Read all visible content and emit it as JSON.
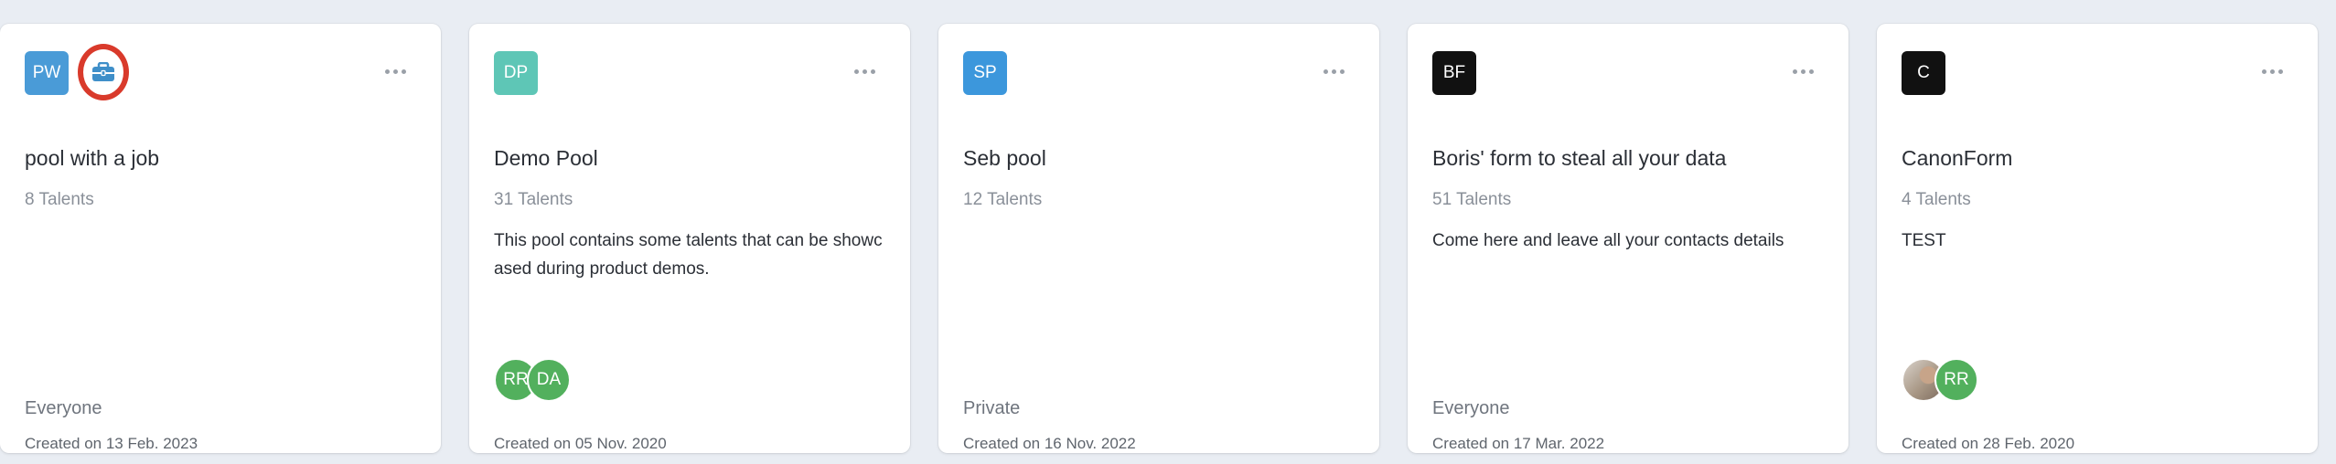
{
  "colors": {
    "page_bg": "#e9edf3",
    "card_bg": "#ffffff",
    "member_green": "#52b05d",
    "highlight_red": "#d93a2b"
  },
  "cards": [
    {
      "initials": "PW",
      "avatar_color": "#4a9bd7",
      "job_icon": "briefcase-icon",
      "title": "pool with a job",
      "talents": "8 Talents",
      "description": "",
      "access": "Everyone",
      "members": [],
      "created": "Created on 13 Feb. 2023"
    },
    {
      "initials": "DP",
      "avatar_color": "#5ec6b6",
      "title": "Demo Pool",
      "talents": "31 Talents",
      "description": "This pool contains some talents that can be showcased during product demos.",
      "access": "",
      "members": [
        "RR",
        "DA"
      ],
      "created": "Created on 05 Nov. 2020"
    },
    {
      "initials": "SP",
      "avatar_color": "#3c97dc",
      "title": "Seb pool",
      "talents": "12 Talents",
      "description": "",
      "access": "Private",
      "members": [],
      "created": "Created on 16 Nov. 2022"
    },
    {
      "initials": "BF",
      "avatar_color": "#111111",
      "title": "Boris' form to steal all your data",
      "talents": "51 Talents",
      "description": "Come here and leave all your contacts details",
      "access": "Everyone",
      "members": [],
      "created": "Created on 17 Mar. 2022"
    },
    {
      "initials": "C",
      "avatar_color": "#111111",
      "title": "CanonForm",
      "talents": "4 Talents",
      "description": "TEST",
      "access": "",
      "members": [
        "photo",
        "RR"
      ],
      "created": "Created on 28 Feb. 2020"
    }
  ]
}
